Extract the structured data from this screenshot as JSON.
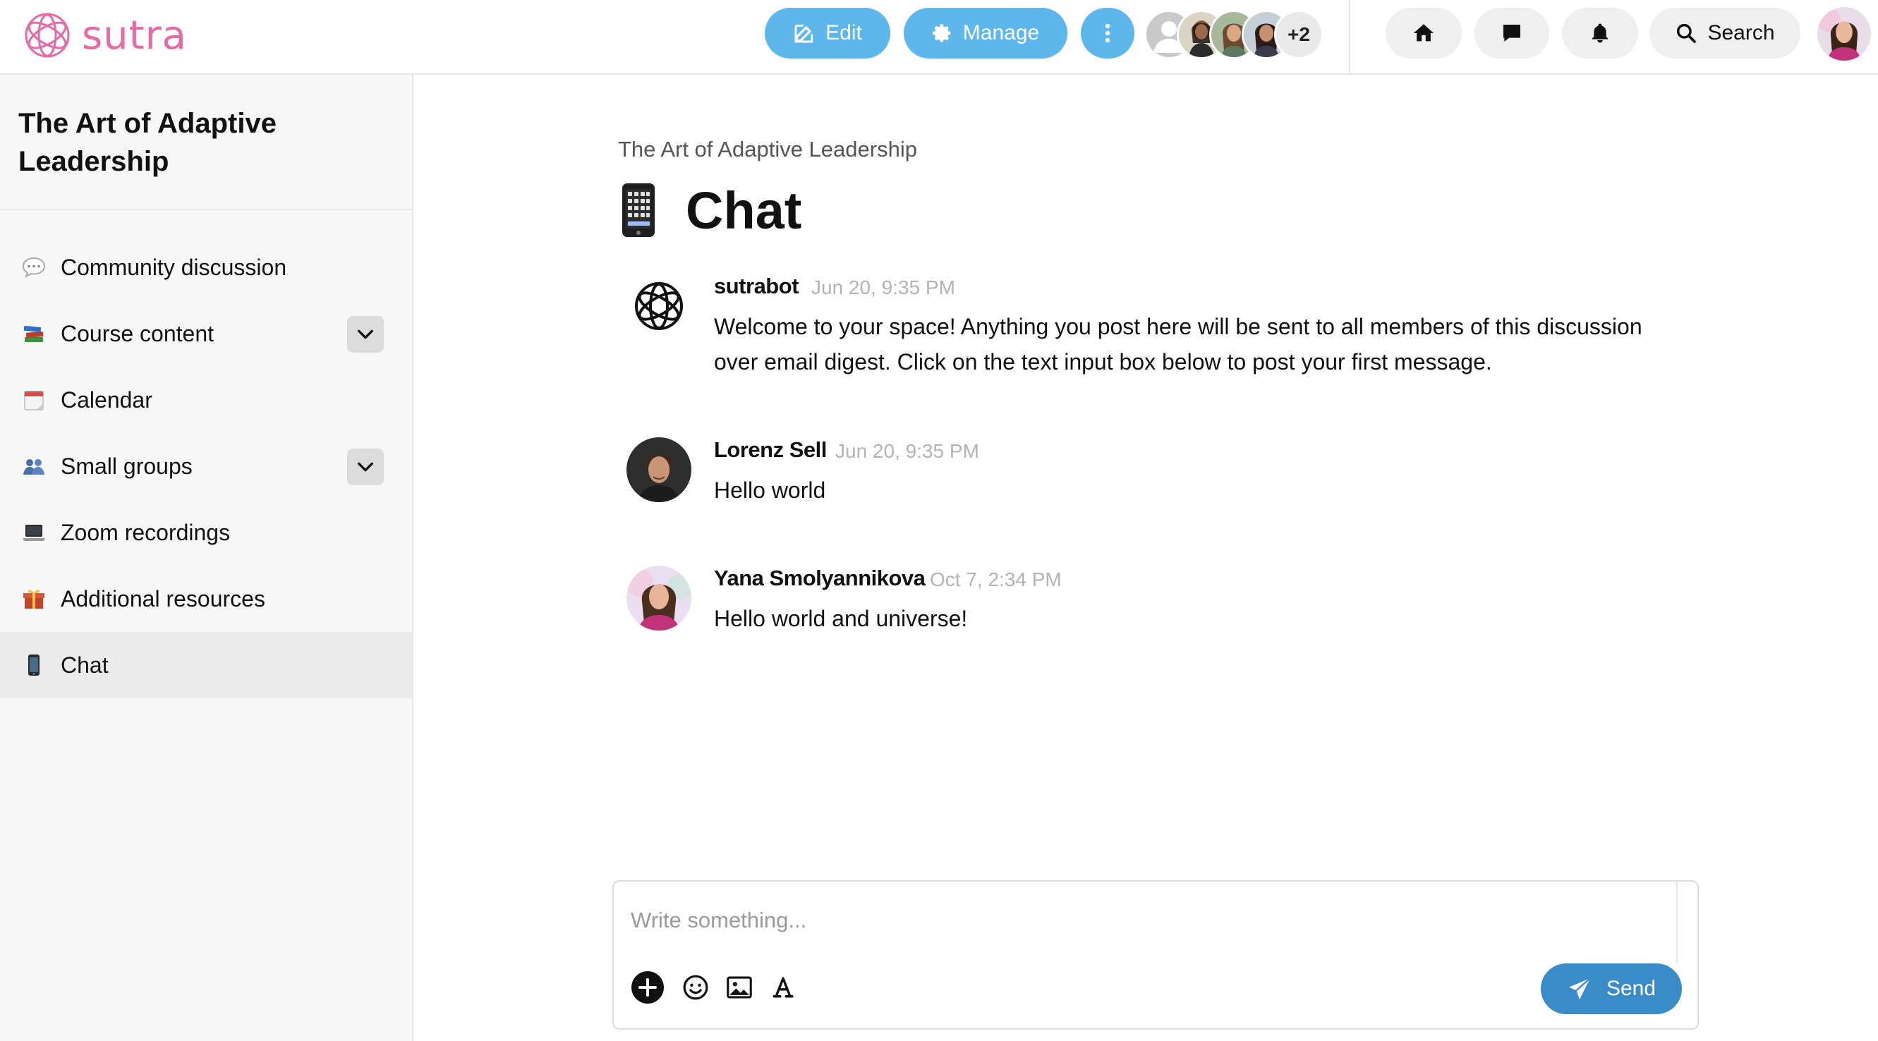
{
  "brand": {
    "name": "sutra",
    "color": "#e66aa6"
  },
  "header": {
    "edit_label": "Edit",
    "manage_label": "Manage",
    "members_more": "+2",
    "search_label": "Search",
    "accent_color": "#5db6ec"
  },
  "sidebar": {
    "space_title": "The Art of Adaptive Leadership",
    "items": [
      {
        "label": "Community discussion",
        "icon": "speech-balloon-emoji",
        "expandable": false,
        "active": false
      },
      {
        "label": "Course content",
        "icon": "books-emoji",
        "expandable": true,
        "active": false
      },
      {
        "label": "Calendar",
        "icon": "calendar-emoji",
        "expandable": false,
        "active": false
      },
      {
        "label": "Small groups",
        "icon": "people-emoji",
        "expandable": true,
        "active": false
      },
      {
        "label": "Zoom recordings",
        "icon": "laptop-emoji",
        "expandable": false,
        "active": false
      },
      {
        "label": "Additional resources",
        "icon": "gift-emoji",
        "expandable": false,
        "active": false
      },
      {
        "label": "Chat",
        "icon": "mobile-phone-emoji",
        "expandable": false,
        "active": true
      }
    ]
  },
  "main": {
    "breadcrumb": "The Art of Adaptive Leadership",
    "title": "Chat",
    "title_icon": "mobile-phone-emoji",
    "messages": [
      {
        "author": "sutrabot",
        "time": "Jun 20, 9:35 PM",
        "body": "Welcome to your space!  Anything you post here will be sent to all members of this discussion over email digest.  Click on the text input box below to post your first message."
      },
      {
        "author": "Lorenz Sell",
        "time": "Jun 20, 9:35 PM",
        "body": "Hello world"
      },
      {
        "author": "Yana Smolyannikova",
        "time": "Oct 7, 2:34 PM",
        "body": "Hello world and universe!"
      }
    ]
  },
  "composer": {
    "placeholder": "Write something...",
    "value": "",
    "send_label": "Send",
    "send_color": "#3a8cc8"
  }
}
